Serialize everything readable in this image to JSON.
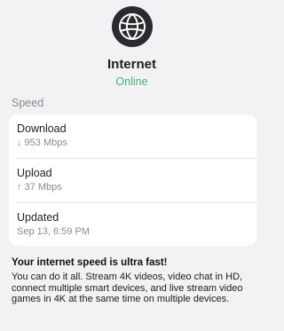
{
  "header": {
    "icon": "globe-icon",
    "title": "Internet",
    "status": "Online",
    "status_color": "#4caf7a"
  },
  "speed_section": {
    "label": "Speed",
    "rows": [
      {
        "label": "Download",
        "value": "↓ 953 Mbps"
      },
      {
        "label": "Upload",
        "value": "↑ 37 Mbps"
      },
      {
        "label": "Updated",
        "value": "Sep 13, 6:59 PM"
      }
    ]
  },
  "summary": {
    "headline": "Your internet speed is ultra fast!",
    "body": "You can do it all. Stream 4K videos, video chat in HD, connect multiple smart devices, and live stream video games in 4K at the same time on multiple devices."
  }
}
